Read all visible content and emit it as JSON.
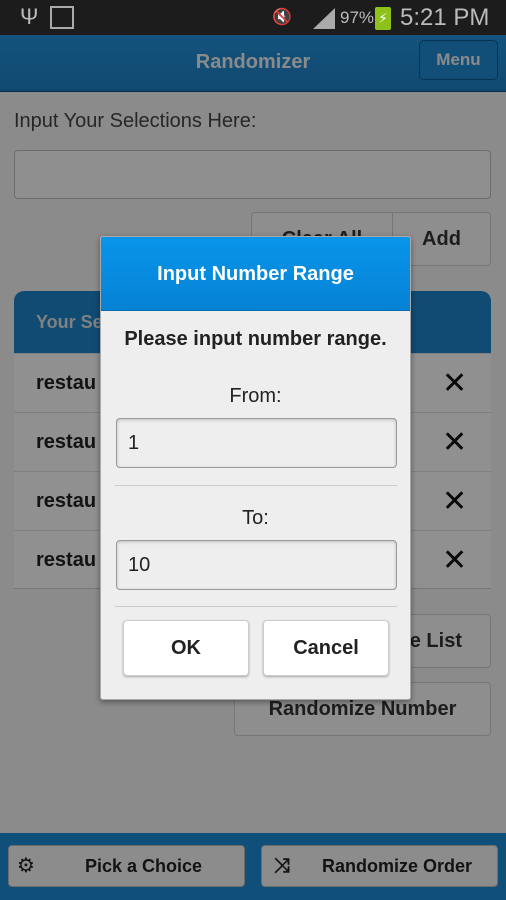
{
  "status_bar": {
    "battery": "97%",
    "time": "5:21 PM",
    "icons": [
      "usb-icon",
      "image-icon",
      "mute-vibrate-icon",
      "signal-icon",
      "battery-charging-icon"
    ]
  },
  "header": {
    "title": "Randomizer",
    "menu_label": "Menu"
  },
  "input_label": "Input Your Selections Here:",
  "input_value": "",
  "clear_all_label": "Clear All",
  "add_label": "Add",
  "list": {
    "header": "Your Se",
    "items": [
      "restau",
      "restau",
      "restau",
      "restau"
    ]
  },
  "randomize_list_label": "e List",
  "randomize_number_label": "Randomize Number",
  "bottom": {
    "pick_label": "Pick a Choice",
    "order_label": "Randomize Order"
  },
  "dialog": {
    "title": "Input Number Range",
    "message": "Please input number range.",
    "from_label": "From:",
    "from_value": "1",
    "to_label": "To:",
    "to_value": "10",
    "ok_label": "OK",
    "cancel_label": "Cancel"
  },
  "colors": {
    "header_blue": "#1c7ec2",
    "dialog_blue": "#0895ea"
  }
}
